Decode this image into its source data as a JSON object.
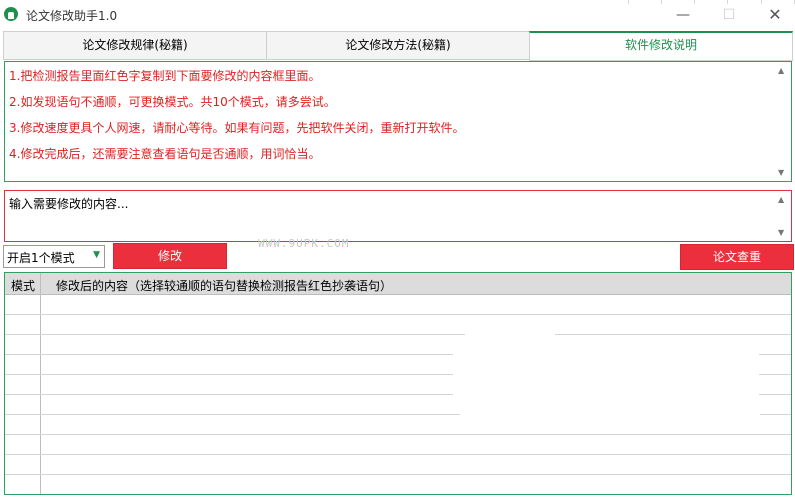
{
  "window": {
    "title": "论文修改助手1.0",
    "minimize": "—",
    "maximize": "☐",
    "close": "✕"
  },
  "tabs": [
    {
      "label": "论文修改规律(秘籍)"
    },
    {
      "label": "论文修改方法(秘籍)"
    },
    {
      "label": "软件修改说明",
      "active": true
    }
  ],
  "instructions": [
    "1.把检测报告里面红色字复制到下面要修改的内容框里面。",
    "2.如发现语句不通顺，可更换模式。共10个模式，请多尝试。",
    "3.修改速度更具个人网速，请耐心等待。如果有问题，先把软件关闭，重新打开软件。",
    "4.修改完成后，还需要注意查看语句是否通顺，用词恰当。"
  ],
  "input": {
    "placeholder": "输入需要修改的内容..."
  },
  "controls": {
    "mode_value": "开启1个模式",
    "modify_label": "修改",
    "check_label": "论文查重",
    "watermark": "WWW.9UPK.COM"
  },
  "table": {
    "headers": [
      "模式",
      "修改后的内容（选择较通顺的语句替换检测报告红色抄袭语句）"
    ]
  },
  "colors": {
    "accent_green": "#1f8f4e",
    "red_text": "#e02020",
    "red_button": "#ec2f3c"
  }
}
